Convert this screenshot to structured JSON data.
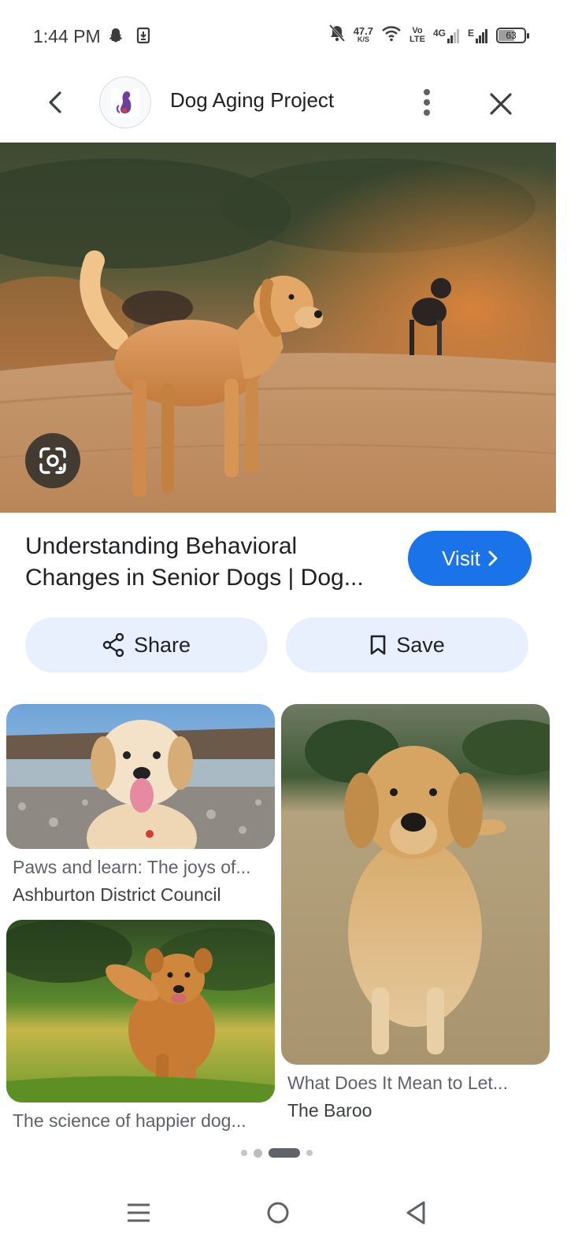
{
  "status_bar": {
    "time": "1:44 PM",
    "net_speed_value": "47.7",
    "net_speed_unit": "K/S",
    "volte_top": "Vo",
    "volte_bottom": "LTE",
    "network_4g": "4G",
    "network_e": "E",
    "battery_level": "63",
    "icons": [
      "snapchat-icon",
      "download-icon",
      "bell-off-icon",
      "wifi-icon",
      "signal-icon"
    ]
  },
  "header": {
    "title": "Dog Aging Project",
    "icons": [
      "back-arrow-icon",
      "more-vert-icon",
      "close-icon"
    ]
  },
  "hero": {
    "lens_icon": "google-lens-icon"
  },
  "result": {
    "title_line1": "Understanding Behavioral",
    "title_line2": "Changes in Senior Dogs | Dog...",
    "visit_label": "Visit",
    "share_label": "Share",
    "save_label": "Save"
  },
  "related": [
    {
      "caption": "Paws and learn: The joys of...",
      "source": "Ashburton District Council"
    },
    {
      "caption": "What Does It Mean to Let...",
      "source": "The Baroo"
    },
    {
      "caption": "The science of happier dog...",
      "source": ""
    }
  ],
  "pager": {
    "count": 4,
    "active_index": 2
  },
  "colors": {
    "accent": "#1a73e8",
    "chip_bg": "#e8f0fe",
    "text_primary": "#202124",
    "text_secondary": "#5f6368"
  }
}
